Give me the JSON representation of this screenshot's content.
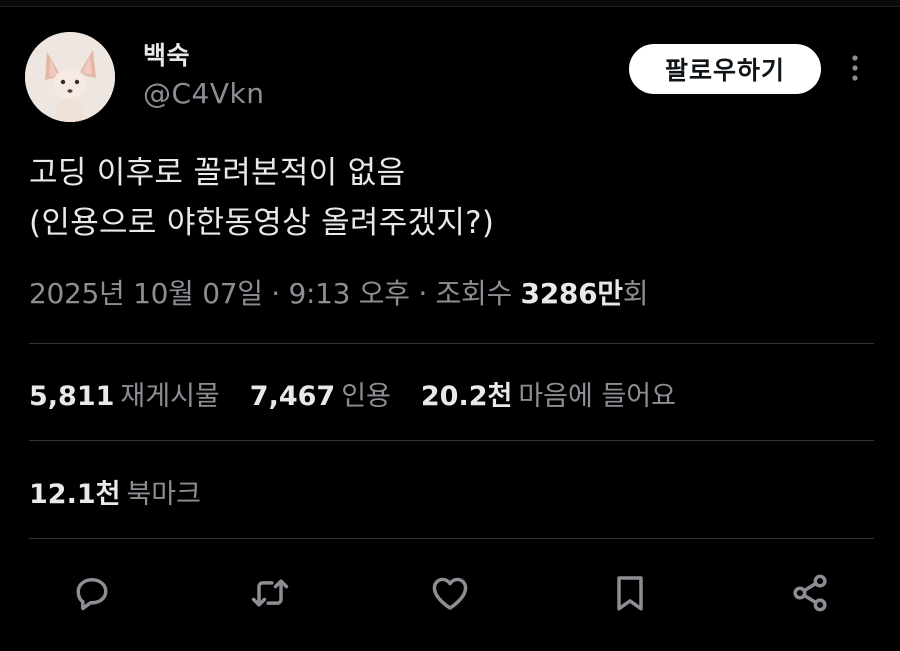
{
  "author": {
    "display_name": "백숙",
    "handle": "@C4Vkn",
    "avatar_icon": "chihuahua-avatar"
  },
  "follow_button": {
    "label": "팔로우하기"
  },
  "more_icon": "more-vertical-icon",
  "tweet": {
    "lines": [
      "고딩 이후로 꼴려본적이 없음",
      "(인용으로 야한동영상 올려주겠지?)"
    ]
  },
  "meta": {
    "date": "2025년 10월 07일",
    "sep1": " · ",
    "time": "9:13 오후",
    "sep2": " · ",
    "views_label": "조회수 ",
    "views_count": "3286만",
    "views_suffix": "회"
  },
  "stats": {
    "retweets": {
      "count": "5,811",
      "label": "재게시물"
    },
    "quotes": {
      "count": "7,467",
      "label": "인용"
    },
    "likes": {
      "count": "20.2천",
      "label": "마음에 들어요"
    },
    "bookmarks": {
      "count": "12.1천",
      "label": "북마크"
    }
  },
  "actions": [
    "reply-icon",
    "retweet-icon",
    "like-icon",
    "bookmark-icon",
    "share-icon"
  ],
  "colors": {
    "background": "#000000",
    "text": "#e7e9ea",
    "muted": "#8b8f94",
    "divider": "#2f3336"
  }
}
